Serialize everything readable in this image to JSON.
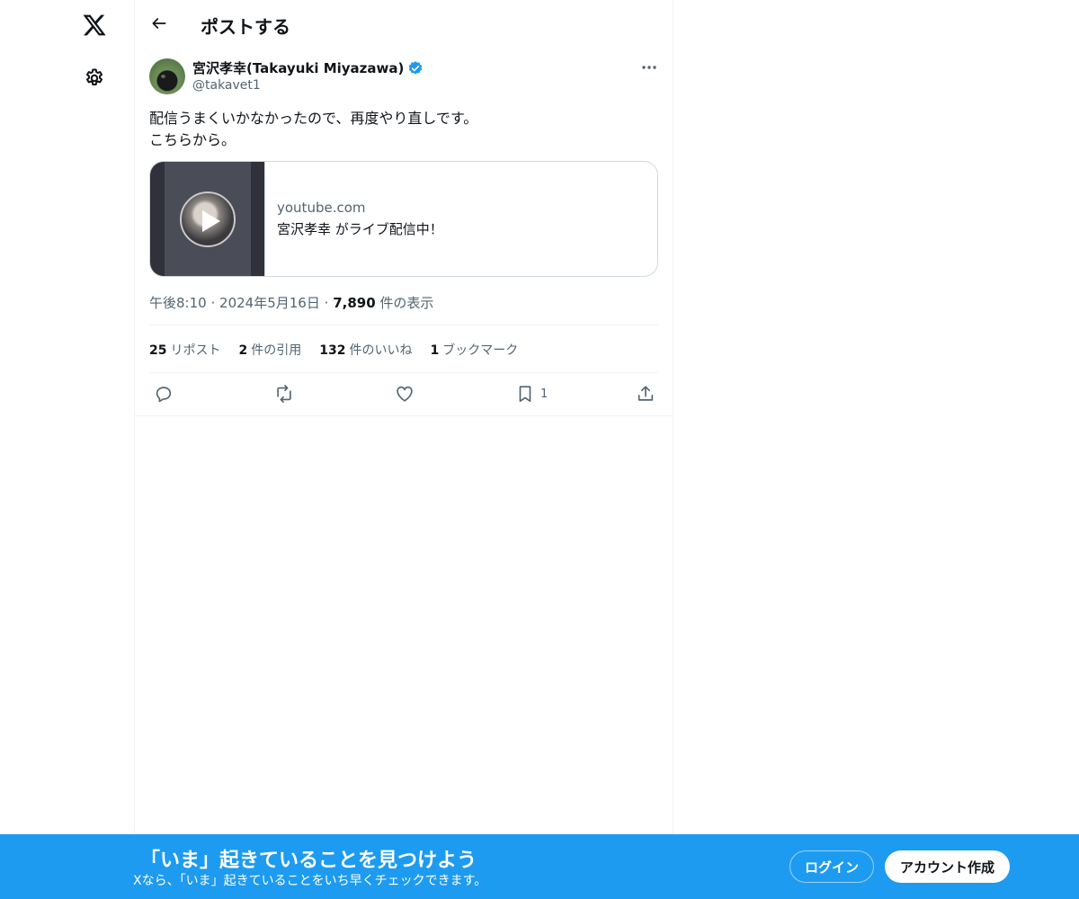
{
  "nav": {
    "logo_icon": "x-logo-icon",
    "settings_icon": "gear-icon"
  },
  "header": {
    "back_icon": "back-arrow-icon",
    "title": "ポストする"
  },
  "tweet": {
    "author_name": "宮沢孝幸(Takayuki Miyazawa)",
    "handle": "@takavet1",
    "verified": true,
    "text_lines": [
      "配信うまくいかなかったので、再度やり直しです。",
      "こちらから。"
    ],
    "card": {
      "domain": "youtube.com",
      "title": "宮沢孝幸 がライブ配信中！"
    },
    "time": "午後8:10",
    "date": "2024年5月16日",
    "views_count": "7,890",
    "views_label": "件の表示",
    "sep": "·",
    "stats": [
      {
        "count": "25",
        "label": "リポスト"
      },
      {
        "count": "2",
        "label": "件の引用"
      },
      {
        "count": "132",
        "label": "件のいいね"
      },
      {
        "count": "1",
        "label": "ブックマーク"
      }
    ],
    "actions": {
      "bookmark_count": "1"
    }
  },
  "bottom_bar": {
    "title": "「いま」起きていることを見つけよう",
    "subtitle": "Xなら、「いま」起きていることをいち早くチェックできます。",
    "login_label": "ログイン",
    "signup_label": "アカウント作成"
  },
  "colors": {
    "accent": "#1d9bf0",
    "text": "#0f1419",
    "secondary_text": "#536471",
    "border": "#eff3f4"
  }
}
